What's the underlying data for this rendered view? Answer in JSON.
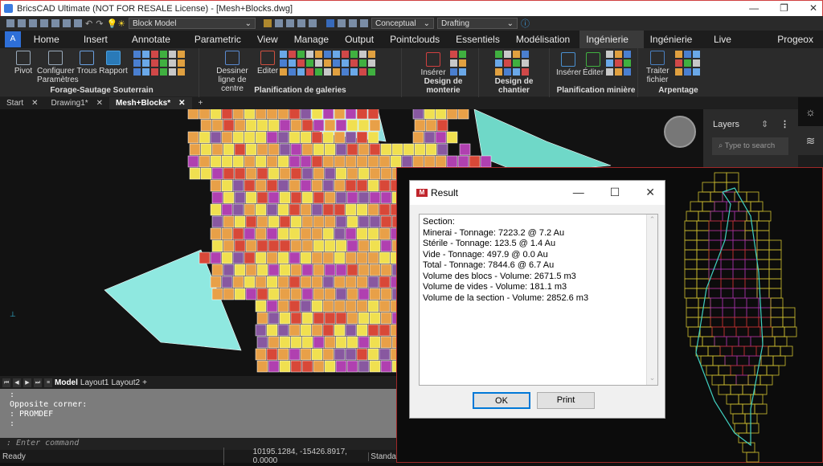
{
  "window": {
    "title": "BricsCAD Ultimate (NOT FOR RESALE License) - [Mesh+Blocks.dwg]"
  },
  "qat": {
    "layer_combo": "Block Model",
    "visual_style": "Conceptual",
    "workspace": "Drafting"
  },
  "ribbon_tabs": [
    "Home",
    "Insert",
    "Annotate",
    "Parametric",
    "View",
    "Manage",
    "Output",
    "Pointclouds",
    "Essentiels",
    "Modélisation",
    "Ingénierie 1",
    "Ingénierie 2",
    "Live Survey",
    "Progeox"
  ],
  "active_tab": "Ingénierie 1",
  "ribbon": {
    "forage": {
      "label": "Forage-Sautage Souterrain",
      "buttons": [
        "Pivot",
        "Configurer Paramètres",
        "Trous",
        "Rapport"
      ]
    },
    "galeries": {
      "label": "Planification de galeries",
      "buttons": [
        "Dessiner ligne de centre",
        "Editer"
      ]
    },
    "monterie": {
      "label": "Design de monterie",
      "buttons": [
        "Insérer"
      ]
    },
    "chantier": {
      "label": "Design de chantier"
    },
    "miniere": {
      "label": "Planification minière",
      "buttons": [
        "Insérer",
        "Éditer"
      ]
    },
    "arpentage": {
      "label": "Arpentage",
      "buttons": [
        "Traiter fichier"
      ]
    }
  },
  "doc_tabs": [
    "Start",
    "Drawing1*",
    "Mesh+Blocks*"
  ],
  "active_doc": "Mesh+Blocks*",
  "layers_panel": {
    "title": "Layers",
    "search_placeholder": "Type to search"
  },
  "layout_tabs": [
    "Model",
    "Layout1",
    "Layout2",
    "+"
  ],
  "command": {
    "history": ":\nOpposite corner:\n: PROMDEF\n:",
    "prompt": ": Enter command"
  },
  "status": {
    "text": "Ready",
    "coords": "10195.1284, -15426.8917, 0.0000",
    "style": "Standa"
  },
  "dialog": {
    "title": "Result",
    "lines": [
      "Section:",
      "Minerai - Tonnage: 7223.2 @ 7.2 Au",
      "Stérile - Tonnage: 123.5 @ 1.4 Au",
      "Vide - Tonnage: 497.9 @ 0.0 Au",
      "Total - Tonnage: 7844.6 @ 6.7 Au",
      "Volume des blocs - Volume: 2671.5 m3",
      "Volume de vides - Volume: 181.1 m3",
      "Volume de la section - Volume: 2852.6 m3"
    ],
    "ok": "OK",
    "print": "Print"
  },
  "colors": {
    "accent": "#2e6fd8",
    "block_colors": [
      "#e8a048",
      "#f0e050",
      "#d84838",
      "#b040b0",
      "#8858a0",
      "#60e0c8"
    ]
  }
}
